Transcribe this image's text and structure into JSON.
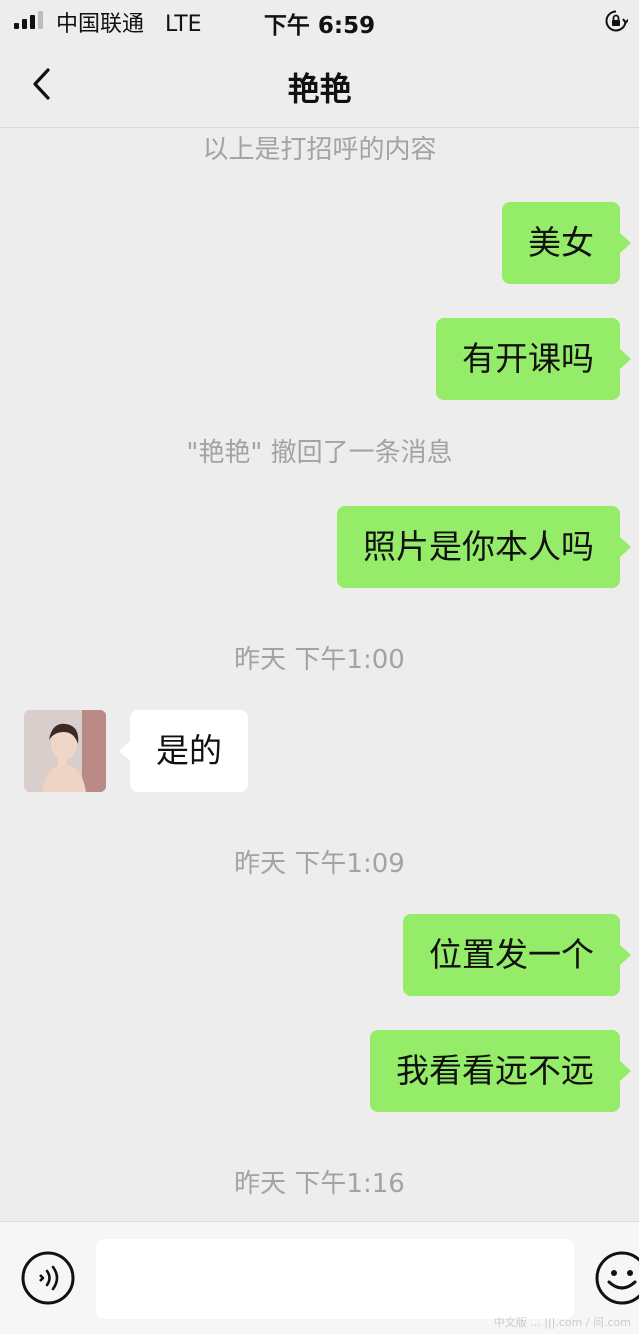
{
  "status_bar": {
    "carrier": "中国联通",
    "network": "LTE",
    "time": "下午 6:59",
    "icons": [
      "signal-icon",
      "orientation-lock-icon"
    ]
  },
  "nav": {
    "back_icon": "chevron-left-icon",
    "title": "艳艳"
  },
  "messages": [
    {
      "kind": "system",
      "text": "以上是打招呼的内容"
    },
    {
      "kind": "outgoing",
      "text": "美女"
    },
    {
      "kind": "outgoing",
      "text": "有开课吗"
    },
    {
      "kind": "system",
      "text": "\"艳艳\" 撤回了一条消息"
    },
    {
      "kind": "outgoing",
      "text": "照片是你本人吗"
    },
    {
      "kind": "timestamp",
      "text": "昨天 下午1:00"
    },
    {
      "kind": "incoming",
      "text": "是的"
    },
    {
      "kind": "timestamp",
      "text": "昨天 下午1:09"
    },
    {
      "kind": "outgoing",
      "text": "位置发一个"
    },
    {
      "kind": "outgoing",
      "text": "我看看远不远"
    },
    {
      "kind": "timestamp",
      "text": "昨天 下午1:16"
    }
  ],
  "input_bar": {
    "voice_icon": "voice-icon",
    "input_value": "",
    "emoji_icon": "emoji-icon"
  },
  "watermark": "中文版 ... |||.com / 问.com",
  "colors": {
    "outgoing_bubble": "#95ec69",
    "incoming_bubble": "#ffffff",
    "background": "#ededed",
    "system_text": "#a3a3a3"
  }
}
